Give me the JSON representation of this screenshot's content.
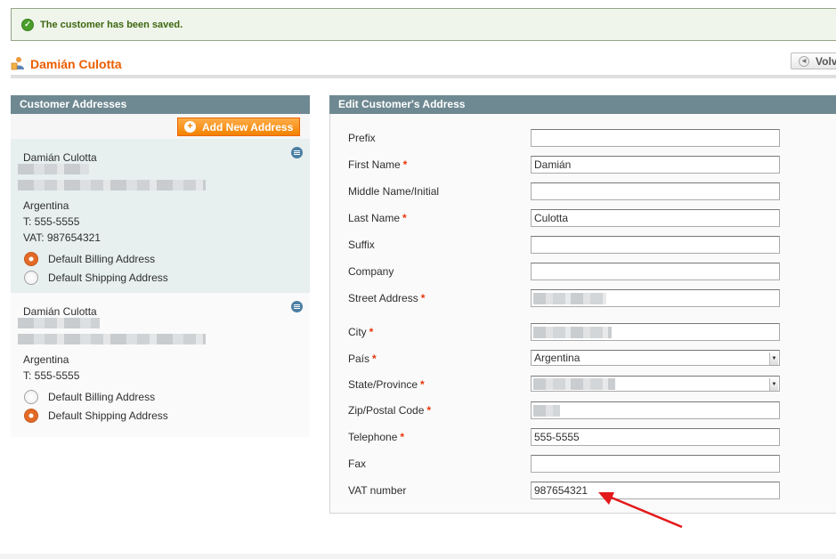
{
  "message": {
    "text": "The customer has been saved."
  },
  "header": {
    "customer_name": "Damián Culotta",
    "back_label": "Volv"
  },
  "left": {
    "title": "Customer Addresses",
    "add_button": "Add New Address",
    "addresses": [
      {
        "name": "Damián Culotta",
        "country": "Argentina",
        "phone": "T: 555-5555",
        "vat": "VAT: 987654321",
        "billing_label": "Default Billing Address",
        "shipping_label": "Default Shipping Address",
        "billing_default": true,
        "shipping_default": false
      },
      {
        "name": "Damián Culotta",
        "country": "Argentina",
        "phone": "T: 555-5555",
        "billing_label": "Default Billing Address",
        "shipping_label": "Default Shipping Address",
        "billing_default": false,
        "shipping_default": true
      }
    ]
  },
  "form": {
    "title": "Edit Customer's Address",
    "fields": [
      {
        "label": "Prefix",
        "required": false,
        "value": ""
      },
      {
        "label": "First Name",
        "required": true,
        "value": "Damián"
      },
      {
        "label": "Middle Name/Initial",
        "required": false,
        "value": ""
      },
      {
        "label": "Last Name",
        "required": true,
        "value": "Culotta"
      },
      {
        "label": "Suffix",
        "required": false,
        "value": ""
      },
      {
        "label": "Company",
        "required": false,
        "value": ""
      },
      {
        "label": "Street Address",
        "required": true,
        "value": ""
      },
      {
        "label": "City",
        "required": true,
        "value": ""
      },
      {
        "label": "País",
        "required": true,
        "value": "Argentina"
      },
      {
        "label": "State/Province",
        "required": true,
        "value": ""
      },
      {
        "label": "Zip/Postal Code",
        "required": true,
        "value": ""
      },
      {
        "label": "Telephone",
        "required": true,
        "value": "555-5555"
      },
      {
        "label": "Fax",
        "required": false,
        "value": ""
      },
      {
        "label": "VAT number",
        "required": false,
        "value": "987654321"
      }
    ],
    "required_mark": "*"
  },
  "colors": {
    "accent": "#eb5e00",
    "header_bg": "#6f8992",
    "annotation_arrow": "#e3191b",
    "success_text": "#3d6611"
  }
}
